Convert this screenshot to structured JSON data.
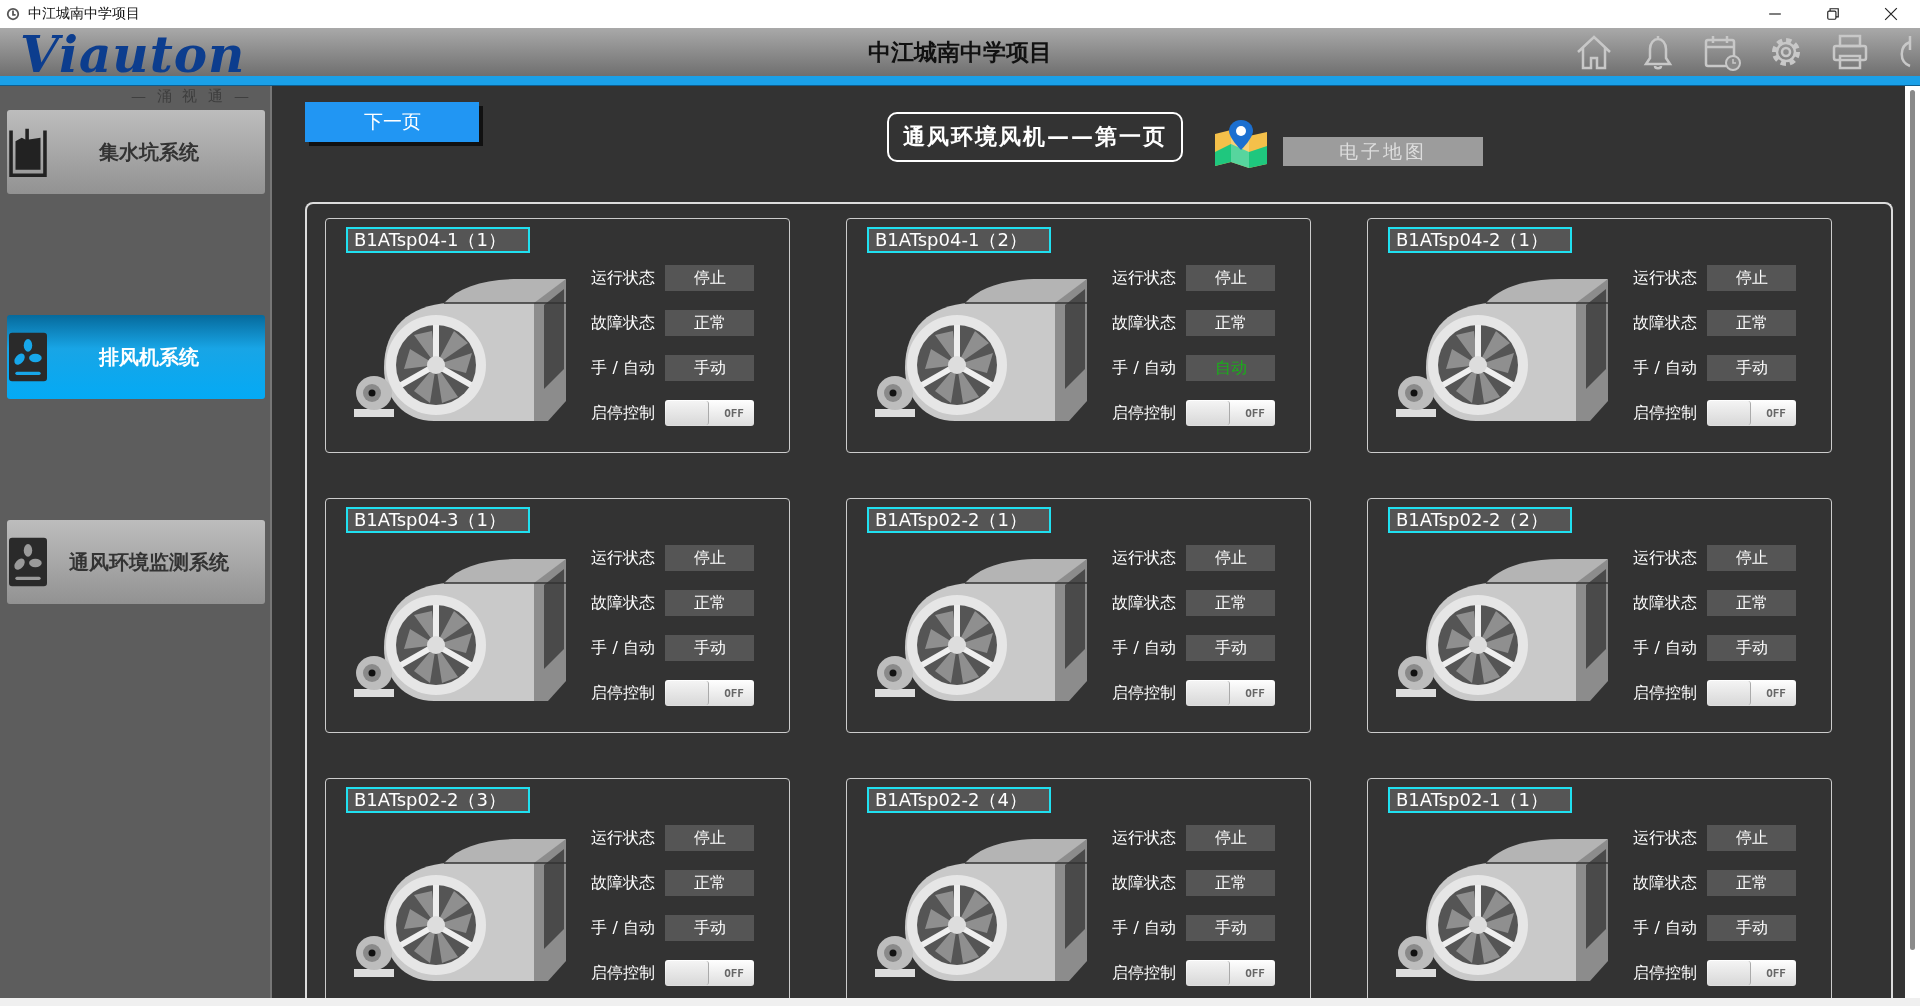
{
  "window": {
    "title": "中江城南中学项目"
  },
  "header": {
    "logo": "Viauton",
    "logo_subtitle": "— 涌 视 通 —",
    "title": "中江城南中学项目"
  },
  "sidebar": {
    "items": [
      {
        "label": "集水坑系统",
        "kind": "pit",
        "selected": false
      },
      {
        "label": "排风机系统",
        "kind": "fan",
        "selected": true
      },
      {
        "label": "通风环境监测系统",
        "kind": "fan",
        "selected": false
      }
    ]
  },
  "toolbar": {
    "next_page": "下一页",
    "page_title": "通风环境风机——第一页",
    "map_button": "电子地图"
  },
  "fans": [
    {
      "name": "B1ATsp04-1（1）",
      "fields": [
        {
          "label": "运行状态",
          "value": "停止",
          "highlight": false
        },
        {
          "label": "故障状态",
          "value": "正常",
          "highlight": false
        },
        {
          "label": "手 / 自动",
          "value": "手动",
          "highlight": false
        }
      ],
      "control": {
        "label": "启停控制",
        "switch": "OFF",
        "on": false
      }
    },
    {
      "name": "B1ATsp04-1（2）",
      "fields": [
        {
          "label": "运行状态",
          "value": "停止",
          "highlight": false
        },
        {
          "label": "故障状态",
          "value": "正常",
          "highlight": false
        },
        {
          "label": "手 / 自动",
          "value": "自动",
          "highlight": true
        }
      ],
      "control": {
        "label": "启停控制",
        "switch": "OFF",
        "on": false
      }
    },
    {
      "name": "B1ATsp04-2（1）",
      "fields": [
        {
          "label": "运行状态",
          "value": "停止",
          "highlight": false
        },
        {
          "label": "故障状态",
          "value": "正常",
          "highlight": false
        },
        {
          "label": "手 / 自动",
          "value": "手动",
          "highlight": false
        }
      ],
      "control": {
        "label": "启停控制",
        "switch": "OFF",
        "on": false
      }
    },
    {
      "name": "B1ATsp04-3（1）",
      "fields": [
        {
          "label": "运行状态",
          "value": "停止",
          "highlight": false
        },
        {
          "label": "故障状态",
          "value": "正常",
          "highlight": false
        },
        {
          "label": "手 / 自动",
          "value": "手动",
          "highlight": false
        }
      ],
      "control": {
        "label": "启停控制",
        "switch": "OFF",
        "on": false
      }
    },
    {
      "name": "B1ATsp02-2（1）",
      "fields": [
        {
          "label": "运行状态",
          "value": "停止",
          "highlight": false
        },
        {
          "label": "故障状态",
          "value": "正常",
          "highlight": false
        },
        {
          "label": "手 / 自动",
          "value": "手动",
          "highlight": false
        }
      ],
      "control": {
        "label": "启停控制",
        "switch": "OFF",
        "on": false
      }
    },
    {
      "name": "B1ATsp02-2（2）",
      "fields": [
        {
          "label": "运行状态",
          "value": "停止",
          "highlight": false
        },
        {
          "label": "故障状态",
          "value": "正常",
          "highlight": false
        },
        {
          "label": "手 / 自动",
          "value": "手动",
          "highlight": false
        }
      ],
      "control": {
        "label": "启停控制",
        "switch": "OFF",
        "on": false
      }
    },
    {
      "name": "B1ATsp02-2（3）",
      "fields": [
        {
          "label": "运行状态",
          "value": "停止",
          "highlight": false
        },
        {
          "label": "故障状态",
          "value": "正常",
          "highlight": false
        },
        {
          "label": "手 / 自动",
          "value": "手动",
          "highlight": false
        }
      ],
      "control": {
        "label": "启停控制",
        "switch": "OFF",
        "on": false
      }
    },
    {
      "name": "B1ATsp02-2（4）",
      "fields": [
        {
          "label": "运行状态",
          "value": "停止",
          "highlight": false
        },
        {
          "label": "故障状态",
          "value": "正常",
          "highlight": false
        },
        {
          "label": "手 / 自动",
          "value": "手动",
          "highlight": false
        }
      ],
      "control": {
        "label": "启停控制",
        "switch": "OFF",
        "on": false
      }
    },
    {
      "name": "B1ATsp02-1（1）",
      "fields": [
        {
          "label": "运行状态",
          "value": "停止",
          "highlight": false
        },
        {
          "label": "故障状态",
          "value": "正常",
          "highlight": false
        },
        {
          "label": "手 / 自动",
          "value": "手动",
          "highlight": false
        }
      ],
      "control": {
        "label": "启停控制",
        "switch": "OFF",
        "on": false
      }
    }
  ]
}
